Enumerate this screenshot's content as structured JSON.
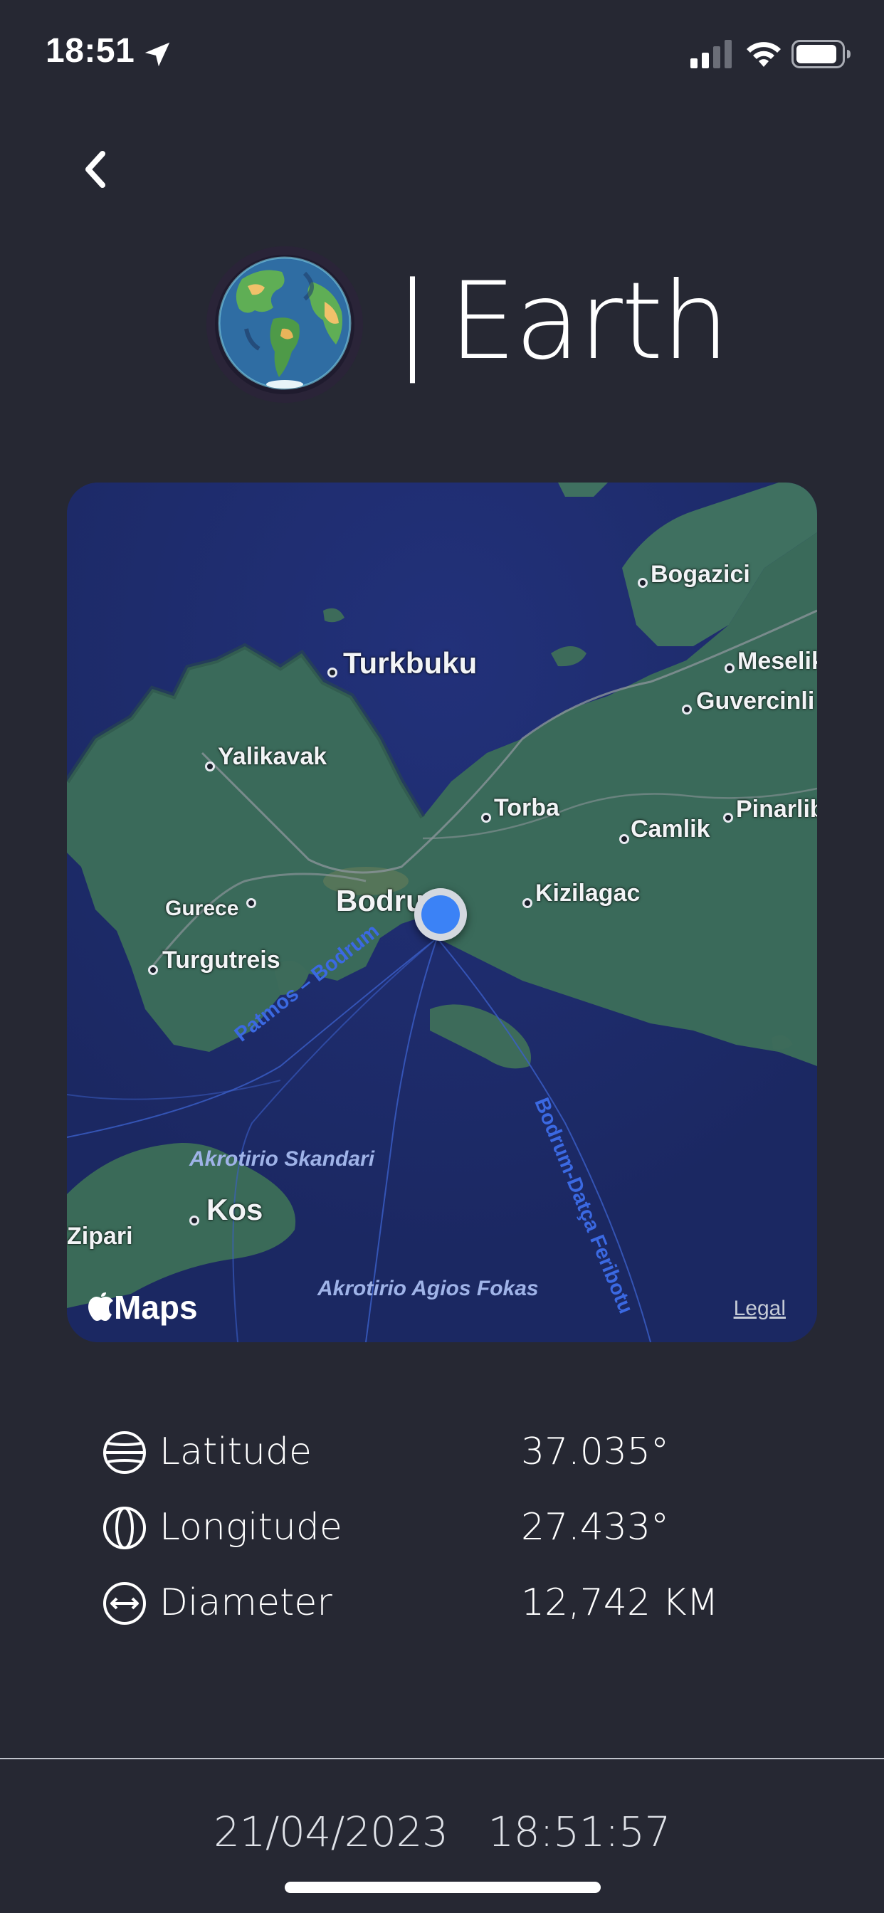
{
  "status_bar": {
    "time": "18:51",
    "icons": [
      "location-arrow-icon",
      "cellular-signal-icon",
      "wifi-icon",
      "battery-icon"
    ]
  },
  "header": {
    "back_icon": "chevron-left-icon",
    "logo": "earth-globe-icon",
    "title_separator": "|",
    "title": "Earth"
  },
  "map": {
    "brand": "Maps",
    "legal": "Legal",
    "places": {
      "bogazici": "Bogazici",
      "turkbuku": "Turkbuku",
      "meselik": "Meselik",
      "guvercinlik": "Guvercinli",
      "yalikavak": "Yalikavak",
      "torba": "Torba",
      "camlik": "Camlik",
      "pinarlibelen": "Pinarlib",
      "gurece": "Gurece",
      "bodrum": "Bodru",
      "kizilagac": "Kizilagac",
      "turgutreis": "Turgutreis",
      "kos": "Kos",
      "zipari": "Zipari"
    },
    "water_labels": {
      "skandari": "Akrotirio Skandari",
      "agios_fokas": "Akrotirio Agios Fokas"
    },
    "ferry_routes": {
      "patmos_bodrum": "Patmos – Bodrum",
      "bodrum_datca": "Bodrum-Datça Feribotu"
    },
    "colors": {
      "water": "#1d2a6a",
      "land": "#3c6a5a",
      "marker": "#3b82f6"
    }
  },
  "info": {
    "latitude": {
      "icon": "latitude-globe-icon",
      "label": "Latitude",
      "value": "37.035°"
    },
    "longitude": {
      "icon": "longitude-globe-icon",
      "label": "Longitude",
      "value": "27.433°"
    },
    "diameter": {
      "icon": "diameter-arrows-icon",
      "label": "Diameter",
      "value": "12,742 KM"
    }
  },
  "footer": {
    "date": "21/04/2023",
    "time": "18:51:57"
  }
}
